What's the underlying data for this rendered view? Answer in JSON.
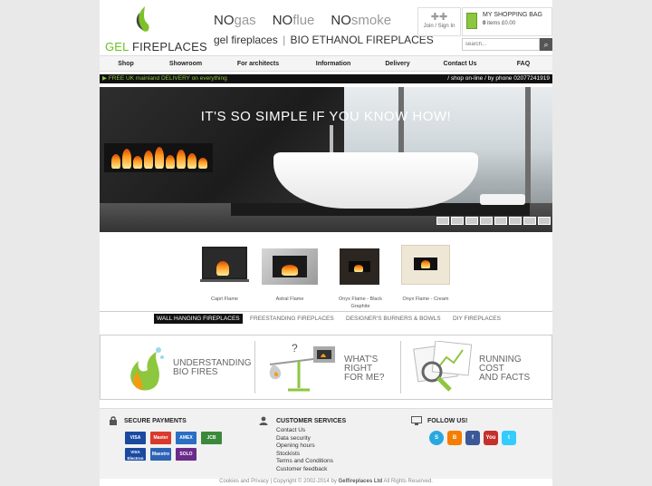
{
  "header": {
    "logo_prefix": "GEL ",
    "logo_suffix": "FIREPLACES",
    "no_items": [
      {
        "no": "NO",
        "text": "gas"
      },
      {
        "no": "NO",
        "text": "flue"
      },
      {
        "no": "NO",
        "text": "smoke"
      }
    ],
    "tagline_left": "gel fireplaces",
    "tagline_sep": "|",
    "tagline_right": "BIO ETHANOL FIREPLACES",
    "join_label": "Join / Sign In",
    "bag_title": "MY SHOPPING BAG",
    "bag_count": "0",
    "bag_items_text": " items £0.00",
    "search_placeholder": "search..."
  },
  "nav": [
    "Shop",
    "Showroom",
    "For architects",
    "Information",
    "Delivery",
    "Contact Us",
    "FAQ"
  ],
  "promo": {
    "left": "FREE UK mainland DELIVERY on everything",
    "right": "/ shop on-line / by phone 02077241919"
  },
  "hero": {
    "title": "IT'S SO SIMPLE IF YOU KNOW HOW!"
  },
  "products": [
    {
      "name": "Capri Flame"
    },
    {
      "name": "Astral Flame"
    },
    {
      "name": "Onyx Flame - Black Graphite"
    },
    {
      "name": "Onyx Flame - Cream"
    }
  ],
  "tabs": [
    {
      "label": "WALL HANGING FIREPLACES",
      "active": true
    },
    {
      "label": "FREESTANDING FIREPLACES",
      "active": false
    },
    {
      "label": "DESIGNER'S BURNERS & BOWLS",
      "active": false
    },
    {
      "label": "DIY FIREPLACES",
      "active": false
    }
  ],
  "info_boxes": [
    {
      "text": "UNDERSTANDING\nBIO FIRES"
    },
    {
      "text": "WHAT'S\nRIGHT\nFOR ME?"
    },
    {
      "text": "RUNNING\nCOST\nAND FACTS"
    }
  ],
  "footer": {
    "payments_title": "SECURE PAYMENTS",
    "cards": [
      "VISA",
      "Master",
      "AMEX",
      "JCB",
      "VISA Electron",
      "Maestro",
      "SOLO"
    ],
    "customer_title": "CUSTOMER SERVICES",
    "customer_links": [
      "Contact Us",
      "Data security",
      "Opening hours",
      "Stockists",
      "Terms and Conditions",
      "Customer feedback"
    ],
    "follow_title": "FOLLOW US!",
    "social": [
      "S",
      "B",
      "f",
      "You",
      "t"
    ],
    "copyright_prefix": "Cookies and Privacy | Copyright © 2002-2014 by ",
    "copyright_company": "Gelfireplaces Ltd",
    "copyright_suffix": " All Rights Reserved."
  },
  "colors": {
    "accent_green": "#8dc63f",
    "promo_bg": "#111111"
  }
}
